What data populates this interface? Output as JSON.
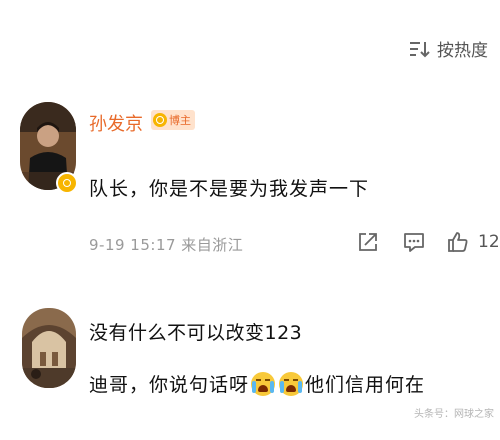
{
  "sort_label": "按热度",
  "comments": [
    {
      "author": "孙发京",
      "badge": "博主",
      "text": "队长，你是不是要为我发声一下",
      "meta": "9-19 15:17 来自浙江",
      "like_count": "12"
    },
    {
      "text_line1": "没有什么不可以改变123",
      "text_line2_before": "迪哥，你说句话呀",
      "text_line2_after": "他们信用何在",
      "emoji_names": [
        "crying-face-emoji",
        "crying-face-emoji"
      ]
    }
  ],
  "watermark": "头条号：网球之家",
  "colors": {
    "author": "#e86a2a",
    "meta": "#9a9a9a",
    "verified": "#f7b500",
    "badge_bg": "#ffe2cc"
  }
}
